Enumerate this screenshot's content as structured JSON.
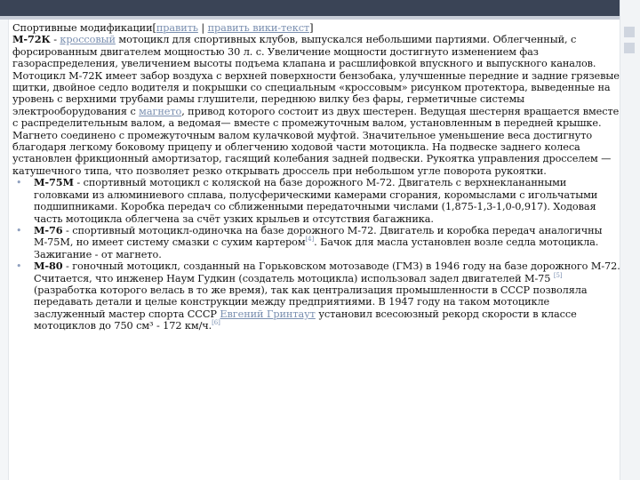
{
  "section": {
    "title": "Спортивные модификации",
    "bracket_open": "[",
    "edit_link": "править",
    "separator": " | ",
    "edit_wiki_link": "править вики-текст",
    "bracket_close": "]"
  },
  "intro": {
    "model": "М-72К",
    "text_before_link": " - ",
    "link1": "кроссовый",
    "text_main": " мотоцикл для спортивных клубов, выпускался небольшими партиями. Облегченный, с форсированным двигателем мощностью 30 л. с. Увеличение мощности достигнуто изменением фаз газораспределения, увеличением высоты подъема клапана и расшлифовкой впускного и выпускного каналов. Мотоцикл М-72К имеет забор воздуха с верхней поверхности бензобака, улучшенные передние и задние грязевые щитки, двойное седло водителя и покрышки со специальным «кроссовым» рисунком протектора, выведенные на уровень с верхними трубами рамы глушители, переднюю вилку без фары, герметичные системы электрооборудования с ",
    "link2": "магнето",
    "text_end": ", привод которого состоит из двух шестерен. Ведущая шестерня вращается вместе с распределительным валом, а ведомая— вместе с промежуточным валом, установленным в передней крышке. Магнето соединено с промежуточным валом кулачковой муфтой. Значительное уменьшение веса достигнуто благодаря легкому боковому прицепу и облегчению ходовой части мотоцикла. На подвеске заднего колеса установлен фрикционный амортизатор, гасящий колебания задней подвески. Рукоятка управления дросселем — катушечного типа, что позволяет резко открывать дроссель при небольшом угле поворота рукоятки."
  },
  "items": [
    {
      "model": "М-75М",
      "text": " - спортивный мотоцикл с коляской на базе дорожного М-72. Двигатель с верхнеклананными головками из алюминиевого сплава, полусферическими камерами сгорания, коромыслами с игольчатыми подшипниками. Коробка передач со сближенными передаточными числами (1,875-1,3-1,0-0,917). Ходовая часть мотоцикла облегчена за счёт узких крыльев и отсутствия багажника."
    },
    {
      "model": "М-76",
      "text": " - спортивный мотоцикл-одиночка на базе дорожного М-72. Двигатель и коробка передач аналогичны М-75М, но имеет систему смазки с сухим картером",
      "ref": "[4]",
      "text_after": ". Бачок для масла установлен возле седла мотоцикла. Зажигание - от магнето."
    },
    {
      "model": "М-80",
      "text": " - гоночный мотоцикл, созданный на Горьковском мотозаводе (ГМЗ) в 1946 году на базе дорожного М-72. Считается, что инженер Наум Гудкин (создатель мотоцикла) использовал задел двигателей М-75 ",
      "ref": "[5]",
      "text_mid": "(разработка которого велась в то же время), так как централизация промышленности в СССР позволяла передавать детали и целые конструкции между предприятиями. В 1947 году на таком мотоцикле заслуженный мастер спорта СССР ",
      "link": "Евгений Гринтаут",
      "text_after": " установил всесоюзный рекорд скорости в классе мотоциклов до 750 см³ - 172 км/ч.",
      "ref2": "[6]"
    }
  ],
  "colors": {
    "topbar": "#3a4456",
    "link": "#7a8fb0",
    "bullet": "#8e9fbe"
  }
}
